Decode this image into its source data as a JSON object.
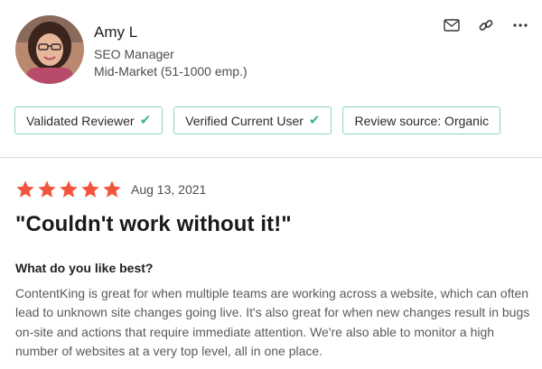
{
  "reviewer": {
    "name": "Amy L",
    "role": "SEO Manager",
    "segment": "Mid-Market (51-1000 emp.)"
  },
  "actions": {
    "icons": [
      "envelope-icon",
      "link-icon",
      "more-dots-icon"
    ]
  },
  "badges": [
    {
      "label": "Validated Reviewer",
      "check": true
    },
    {
      "label": "Verified Current User",
      "check": true
    },
    {
      "label": "Review source: Organic",
      "check": false
    }
  ],
  "review": {
    "rating": 5,
    "max_rating": 5,
    "date": "Aug 13, 2021",
    "title": "\"Couldn't work without it!\"",
    "question": "What do you like best?",
    "answer": "ContentKing is great for when multiple teams are working across a website, which can often lead to unknown site changes going live. It's also great for when new changes result in bugs on-site and actions that require immediate attention. We're also able to monitor a high number of websites at a very top level, all in one place."
  },
  "colors": {
    "star": "#f2553d",
    "badge_border": "#8fd3c4",
    "check": "#39b49a",
    "divider": "#d9d9d9"
  }
}
